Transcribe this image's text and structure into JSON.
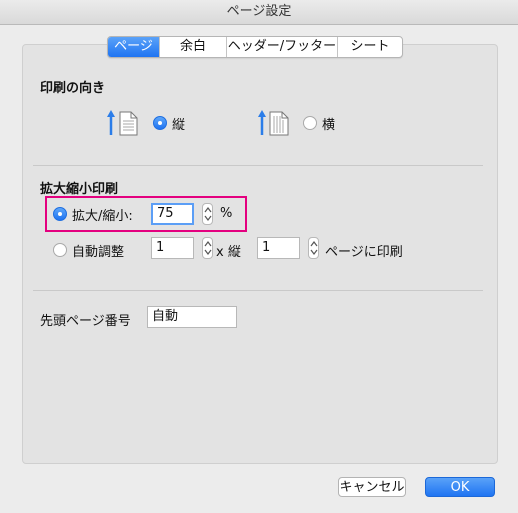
{
  "window": {
    "title": "ページ設定"
  },
  "tabs": [
    {
      "label": "ページ",
      "active": true
    },
    {
      "label": "余白",
      "active": false
    },
    {
      "label": "ヘッダー/フッター",
      "active": false
    },
    {
      "label": "シート",
      "active": false
    }
  ],
  "orientation": {
    "heading": "印刷の向き",
    "portrait_label": "縦",
    "landscape_label": "横",
    "selected": "縦"
  },
  "scaling": {
    "heading": "拡大縮小印刷",
    "adjust_label": "拡大/縮小:",
    "adjust_value": "75",
    "percent_symbol": "%",
    "fit_label": "自動調整",
    "fit_wide_value": "1",
    "times_label": "x 縦",
    "fit_tall_value": "1",
    "fit_suffix": "ページに印刷",
    "selected": "拡大/縮小"
  },
  "first_page": {
    "label": "先頭ページ番号",
    "value": "自動"
  },
  "buttons": {
    "cancel_label": "キャンセル",
    "ok_label": "OK"
  },
  "colors": {
    "accent": "#1f74f2",
    "highlight": "#e4007f"
  }
}
